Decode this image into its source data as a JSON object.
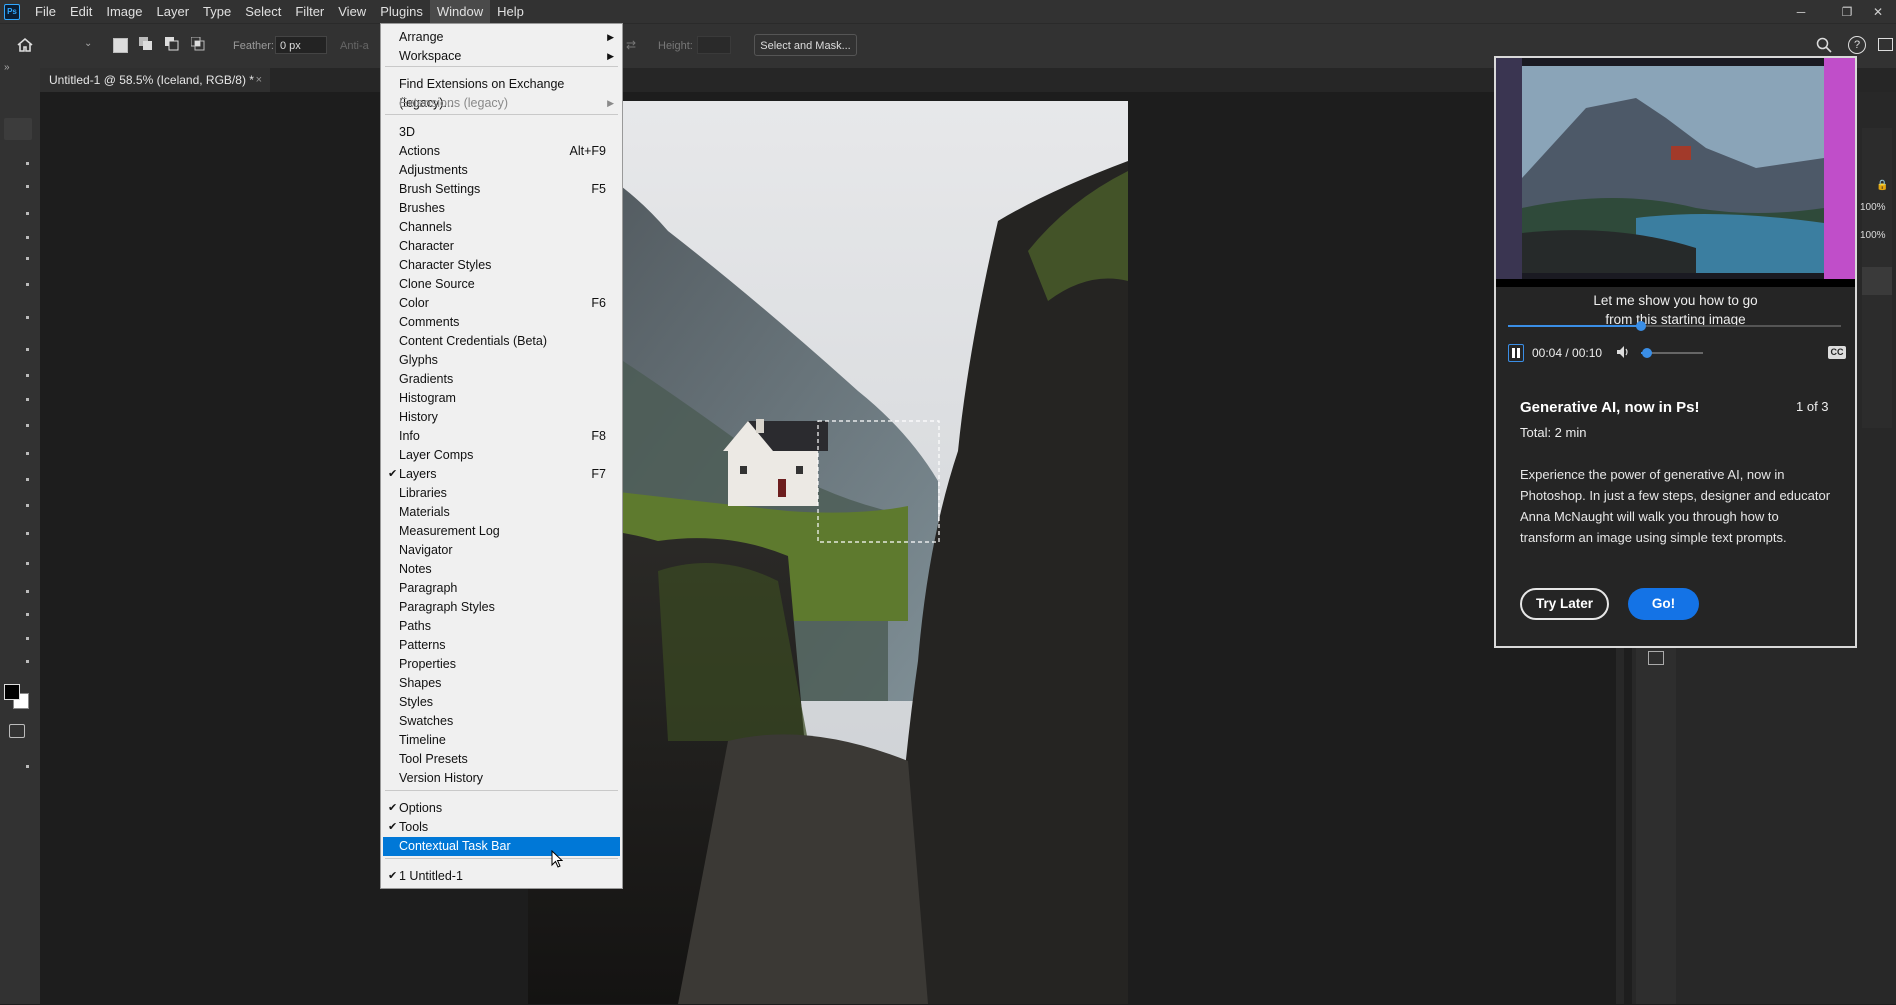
{
  "app": {
    "logo": "Ps"
  },
  "menubar": {
    "items": [
      "File",
      "Edit",
      "Image",
      "Layer",
      "Type",
      "Select",
      "Filter",
      "View",
      "Plugins",
      "Window",
      "Help"
    ],
    "active": "Window"
  },
  "options": {
    "feather_label": "Feather:",
    "feather_value": "0 px",
    "antialias_label": "Anti-a",
    "height_label": "Height:",
    "select_mask_label": "Select and Mask..."
  },
  "document": {
    "tab_title": "Untitled-1 @ 58.5% (Iceland, RGB/8) *"
  },
  "window_menu": {
    "items": [
      {
        "label": "Arrange",
        "submenu": true
      },
      {
        "label": "Workspace",
        "submenu": true
      },
      {
        "label": "Find Extensions on Exchange (legacy)..."
      },
      {
        "label": "Extensions (legacy)",
        "submenu": true,
        "disabled": true
      },
      {
        "label": "3D"
      },
      {
        "label": "Actions",
        "shortcut": "Alt+F9"
      },
      {
        "label": "Adjustments"
      },
      {
        "label": "Brush Settings",
        "shortcut": "F5"
      },
      {
        "label": "Brushes"
      },
      {
        "label": "Channels"
      },
      {
        "label": "Character"
      },
      {
        "label": "Character Styles"
      },
      {
        "label": "Clone Source"
      },
      {
        "label": "Color",
        "shortcut": "F6"
      },
      {
        "label": "Comments"
      },
      {
        "label": "Content Credentials (Beta)"
      },
      {
        "label": "Glyphs"
      },
      {
        "label": "Gradients"
      },
      {
        "label": "Histogram"
      },
      {
        "label": "History"
      },
      {
        "label": "Info",
        "shortcut": "F8"
      },
      {
        "label": "Layer Comps"
      },
      {
        "label": "Layers",
        "shortcut": "F7",
        "checked": true
      },
      {
        "label": "Libraries"
      },
      {
        "label": "Materials"
      },
      {
        "label": "Measurement Log"
      },
      {
        "label": "Navigator"
      },
      {
        "label": "Notes"
      },
      {
        "label": "Paragraph"
      },
      {
        "label": "Paragraph Styles"
      },
      {
        "label": "Paths"
      },
      {
        "label": "Patterns"
      },
      {
        "label": "Properties"
      },
      {
        "label": "Shapes"
      },
      {
        "label": "Styles"
      },
      {
        "label": "Swatches"
      },
      {
        "label": "Timeline"
      },
      {
        "label": "Tool Presets"
      },
      {
        "label": "Version History"
      },
      {
        "label": "Options",
        "checked": true
      },
      {
        "label": "Tools",
        "checked": true
      },
      {
        "label": "Contextual Task Bar",
        "highlighted": true
      },
      {
        "label": "1 Untitled-1",
        "checked": true
      }
    ]
  },
  "learn_panel": {
    "caption_line1": "Let me show you how to go",
    "caption_line2": "from this starting image",
    "time": "00:04 / 00:10",
    "cc_label": "CC",
    "title": "Generative AI, now in Ps!",
    "counter": "1 of 3",
    "total": "Total: 2 min",
    "description": "Experience the power of generative AI, now in Photoshop. In just a few steps, designer and educator Anna McNaught will walk you through how to transform an image using simple text prompts.",
    "try_later": "Try Later",
    "go": "Go!",
    "video_progress": 0.4,
    "volume": 0.1
  },
  "right_panel": {
    "opacity": "100%",
    "fill": "100%"
  },
  "colors": {
    "accent": "#0078d7",
    "go_button": "#1473e6",
    "panel": "#252525",
    "menubar": "#323232"
  }
}
